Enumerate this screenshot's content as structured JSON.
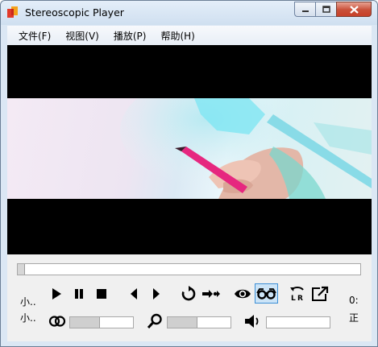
{
  "window": {
    "title": "Stereoscopic Player",
    "controls": [
      "minimize-icon",
      "maximize-icon",
      "close-icon"
    ]
  },
  "menu": {
    "items": [
      "文件(F)",
      "视图(V)",
      "播放(P)",
      "帮助(H)"
    ]
  },
  "controls": {
    "left_labels": [
      "小..",
      "小.."
    ],
    "right_labels": [
      "0:",
      "正"
    ],
    "seek_position": 0.0,
    "sliders": {
      "stereo_level": 0.47,
      "zoom_level": 0.47,
      "volume_level": 0.0
    },
    "buttons": [
      {
        "name": "play-icon"
      },
      {
        "name": "pause-icon"
      },
      {
        "name": "stop-icon"
      },
      {
        "name": "previous-frame-icon"
      },
      {
        "name": "next-frame-icon"
      },
      {
        "name": "loop-icon"
      },
      {
        "name": "step-forward-icon"
      },
      {
        "name": "eye-icon"
      },
      {
        "name": "glasses-icon",
        "active": true
      },
      {
        "name": "swap-lr-icon"
      },
      {
        "name": "external-window-icon"
      }
    ],
    "colors": {
      "active_fill": "#cce4f7",
      "active_border": "#3d8fd6"
    }
  }
}
